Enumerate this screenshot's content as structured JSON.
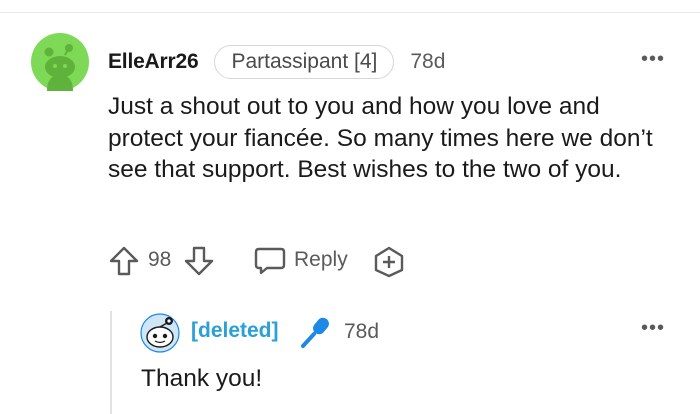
{
  "comment": {
    "username": "ElleArr26",
    "flair": "Partassipant [4]",
    "age": "78d",
    "more": "•••",
    "body": "Just a shout out to you and how you love and protect your fiancée. So many times here we don’t see that support. Best wishes to the two of you.",
    "avatar_color": "#7ed957",
    "actions": {
      "score": "98",
      "reply_label": "Reply"
    }
  },
  "reply": {
    "username": "[deleted]",
    "age": "78d",
    "more": "•••",
    "body": "Thank you!",
    "username_color": "#2a9fd8",
    "mic_color": "#1e88e5"
  },
  "icons": [
    "upvote-icon",
    "downvote-icon",
    "reply-bubble-icon",
    "award-plus-icon",
    "microphone-icon",
    "more-options-icon"
  ]
}
